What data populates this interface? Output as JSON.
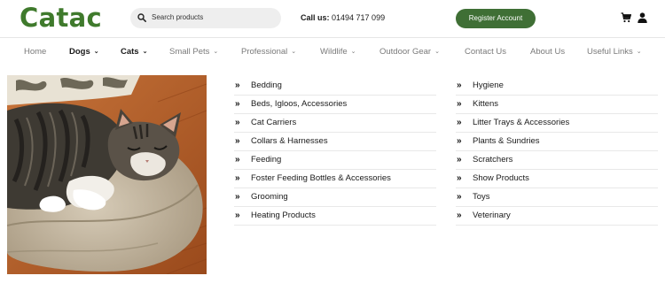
{
  "header": {
    "logo_text": "Catac",
    "search_placeholder": "Search products",
    "call_label": "Call us:",
    "call_number": " 01494 717 099",
    "register_label": "Register Account",
    "brand_color": "#3f7a2c",
    "button_color": "#3f6f35",
    "icons": [
      "search-icon",
      "cart-icon",
      "user-icon"
    ]
  },
  "nav": {
    "items": [
      {
        "label": "Home",
        "dropdown": false,
        "active": false
      },
      {
        "label": "Dogs",
        "dropdown": true,
        "active": true
      },
      {
        "label": "Cats",
        "dropdown": true,
        "active": true
      },
      {
        "label": "Small Pets",
        "dropdown": true,
        "active": false
      },
      {
        "label": "Professional",
        "dropdown": true,
        "active": false
      },
      {
        "label": "Wildlife",
        "dropdown": true,
        "active": false
      },
      {
        "label": "Outdoor Gear",
        "dropdown": true,
        "active": false
      },
      {
        "label": "Contact Us",
        "dropdown": false,
        "active": false
      },
      {
        "label": "About Us",
        "dropdown": false,
        "active": false
      },
      {
        "label": "Useful Links",
        "dropdown": true,
        "active": false
      }
    ],
    "chevron": "⌄"
  },
  "menu": {
    "bullet": "»",
    "left": [
      "Bedding",
      "Beds, Igloos, Accessories",
      "Cat Carriers",
      "Collars & Harnesses",
      "Feeding",
      "Foster Feeding Bottles & Accessories",
      "Grooming",
      "Heating Products"
    ],
    "right": [
      "Hygiene",
      "Kittens",
      "Litter Trays & Accessories",
      "Plants & Sundries",
      "Scratchers",
      "Show Products",
      "Toys",
      "Veterinary"
    ]
  }
}
